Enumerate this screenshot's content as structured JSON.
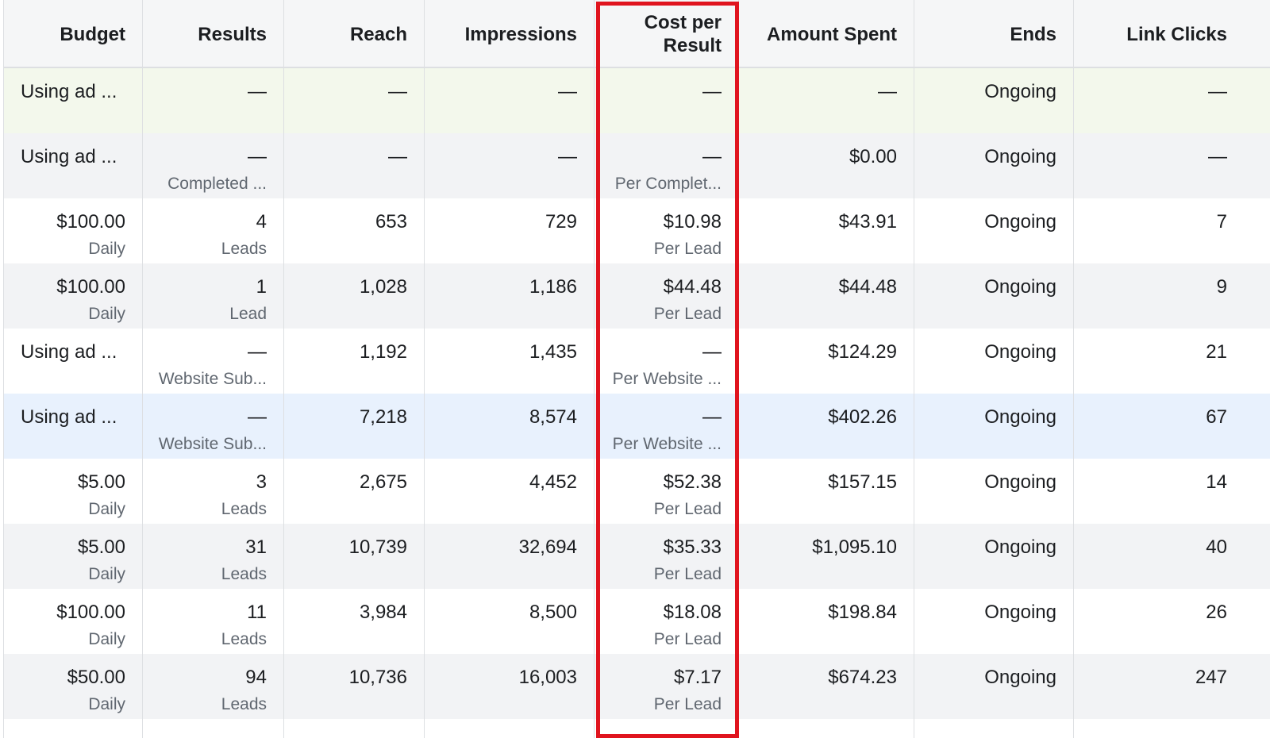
{
  "columns": [
    {
      "key": "budget",
      "label": "Budget"
    },
    {
      "key": "results",
      "label": "Results"
    },
    {
      "key": "reach",
      "label": "Reach"
    },
    {
      "key": "impressions",
      "label": "Impressions"
    },
    {
      "key": "cost",
      "label": "Cost per Result"
    },
    {
      "key": "amount",
      "label": "Amount Spent"
    },
    {
      "key": "ends",
      "label": "Ends"
    },
    {
      "key": "clicks",
      "label": "Link Clicks"
    }
  ],
  "header": {
    "budget": "Budget",
    "results": "Results",
    "reach": "Reach",
    "impressions": "Impressions",
    "cost_line1": "Cost per",
    "cost_line2": "Result",
    "amount": "Amount Spent",
    "ends": "Ends",
    "clicks": "Link Clicks"
  },
  "colors": {
    "row_green": "#f3f8ec",
    "row_gray": "#f2f3f5",
    "row_blue": "#e8f1fd",
    "row_white": "#ffffff",
    "highlight": "#e0141e"
  },
  "rows": [
    {
      "bg": "#f3f8ec",
      "budget": "Using ad ...",
      "budget_sub": "",
      "results": "—",
      "results_sub": "",
      "reach": "—",
      "impressions": "—",
      "cost": "—",
      "cost_sub": "",
      "amount": "—",
      "ends": "Ongoing",
      "clicks": "—"
    },
    {
      "bg": "#f2f3f5",
      "budget": "Using ad ...",
      "budget_sub": "",
      "results": "—",
      "results_sub": "Completed ...",
      "reach": "—",
      "impressions": "—",
      "cost": "—",
      "cost_sub": "Per Complet...",
      "amount": "$0.00",
      "ends": "Ongoing",
      "clicks": "—"
    },
    {
      "bg": "#ffffff",
      "budget": "$100.00",
      "budget_sub": "Daily",
      "results": "4",
      "results_sub": "Leads",
      "reach": "653",
      "impressions": "729",
      "cost": "$10.98",
      "cost_sub": "Per Lead",
      "amount": "$43.91",
      "ends": "Ongoing",
      "clicks": "7"
    },
    {
      "bg": "#f2f3f5",
      "budget": "$100.00",
      "budget_sub": "Daily",
      "results": "1",
      "results_sub": "Lead",
      "reach": "1,028",
      "impressions": "1,186",
      "cost": "$44.48",
      "cost_sub": "Per Lead",
      "amount": "$44.48",
      "ends": "Ongoing",
      "clicks": "9"
    },
    {
      "bg": "#ffffff",
      "budget": "Using ad ...",
      "budget_sub": "",
      "results": "—",
      "results_sub": "Website Sub...",
      "reach": "1,192",
      "impressions": "1,435",
      "cost": "—",
      "cost_sub": "Per Website ...",
      "amount": "$124.29",
      "ends": "Ongoing",
      "clicks": "21"
    },
    {
      "bg": "#e8f1fd",
      "budget": "Using ad ...",
      "budget_sub": "",
      "results": "—",
      "results_sub": "Website Sub...",
      "reach": "7,218",
      "impressions": "8,574",
      "cost": "—",
      "cost_sub": "Per Website ...",
      "amount": "$402.26",
      "ends": "Ongoing",
      "clicks": "67"
    },
    {
      "bg": "#ffffff",
      "budget": "$5.00",
      "budget_sub": "Daily",
      "results": "3",
      "results_sub": "Leads",
      "reach": "2,675",
      "impressions": "4,452",
      "cost": "$52.38",
      "cost_sub": "Per Lead",
      "amount": "$157.15",
      "ends": "Ongoing",
      "clicks": "14"
    },
    {
      "bg": "#f2f3f5",
      "budget": "$5.00",
      "budget_sub": "Daily",
      "results": "31",
      "results_sub": "Leads",
      "reach": "10,739",
      "impressions": "32,694",
      "cost": "$35.33",
      "cost_sub": "Per Lead",
      "amount": "$1,095.10",
      "ends": "Ongoing",
      "clicks": "40"
    },
    {
      "bg": "#ffffff",
      "budget": "$100.00",
      "budget_sub": "Daily",
      "results": "11",
      "results_sub": "Leads",
      "reach": "3,984",
      "impressions": "8,500",
      "cost": "$18.08",
      "cost_sub": "Per Lead",
      "amount": "$198.84",
      "ends": "Ongoing",
      "clicks": "26"
    },
    {
      "bg": "#f2f3f5",
      "budget": "$50.00",
      "budget_sub": "Daily",
      "results": "94",
      "results_sub": "Leads",
      "reach": "10,736",
      "impressions": "16,003",
      "cost": "$7.17",
      "cost_sub": "Per Lead",
      "amount": "$674.23",
      "ends": "Ongoing",
      "clicks": "247"
    }
  ]
}
